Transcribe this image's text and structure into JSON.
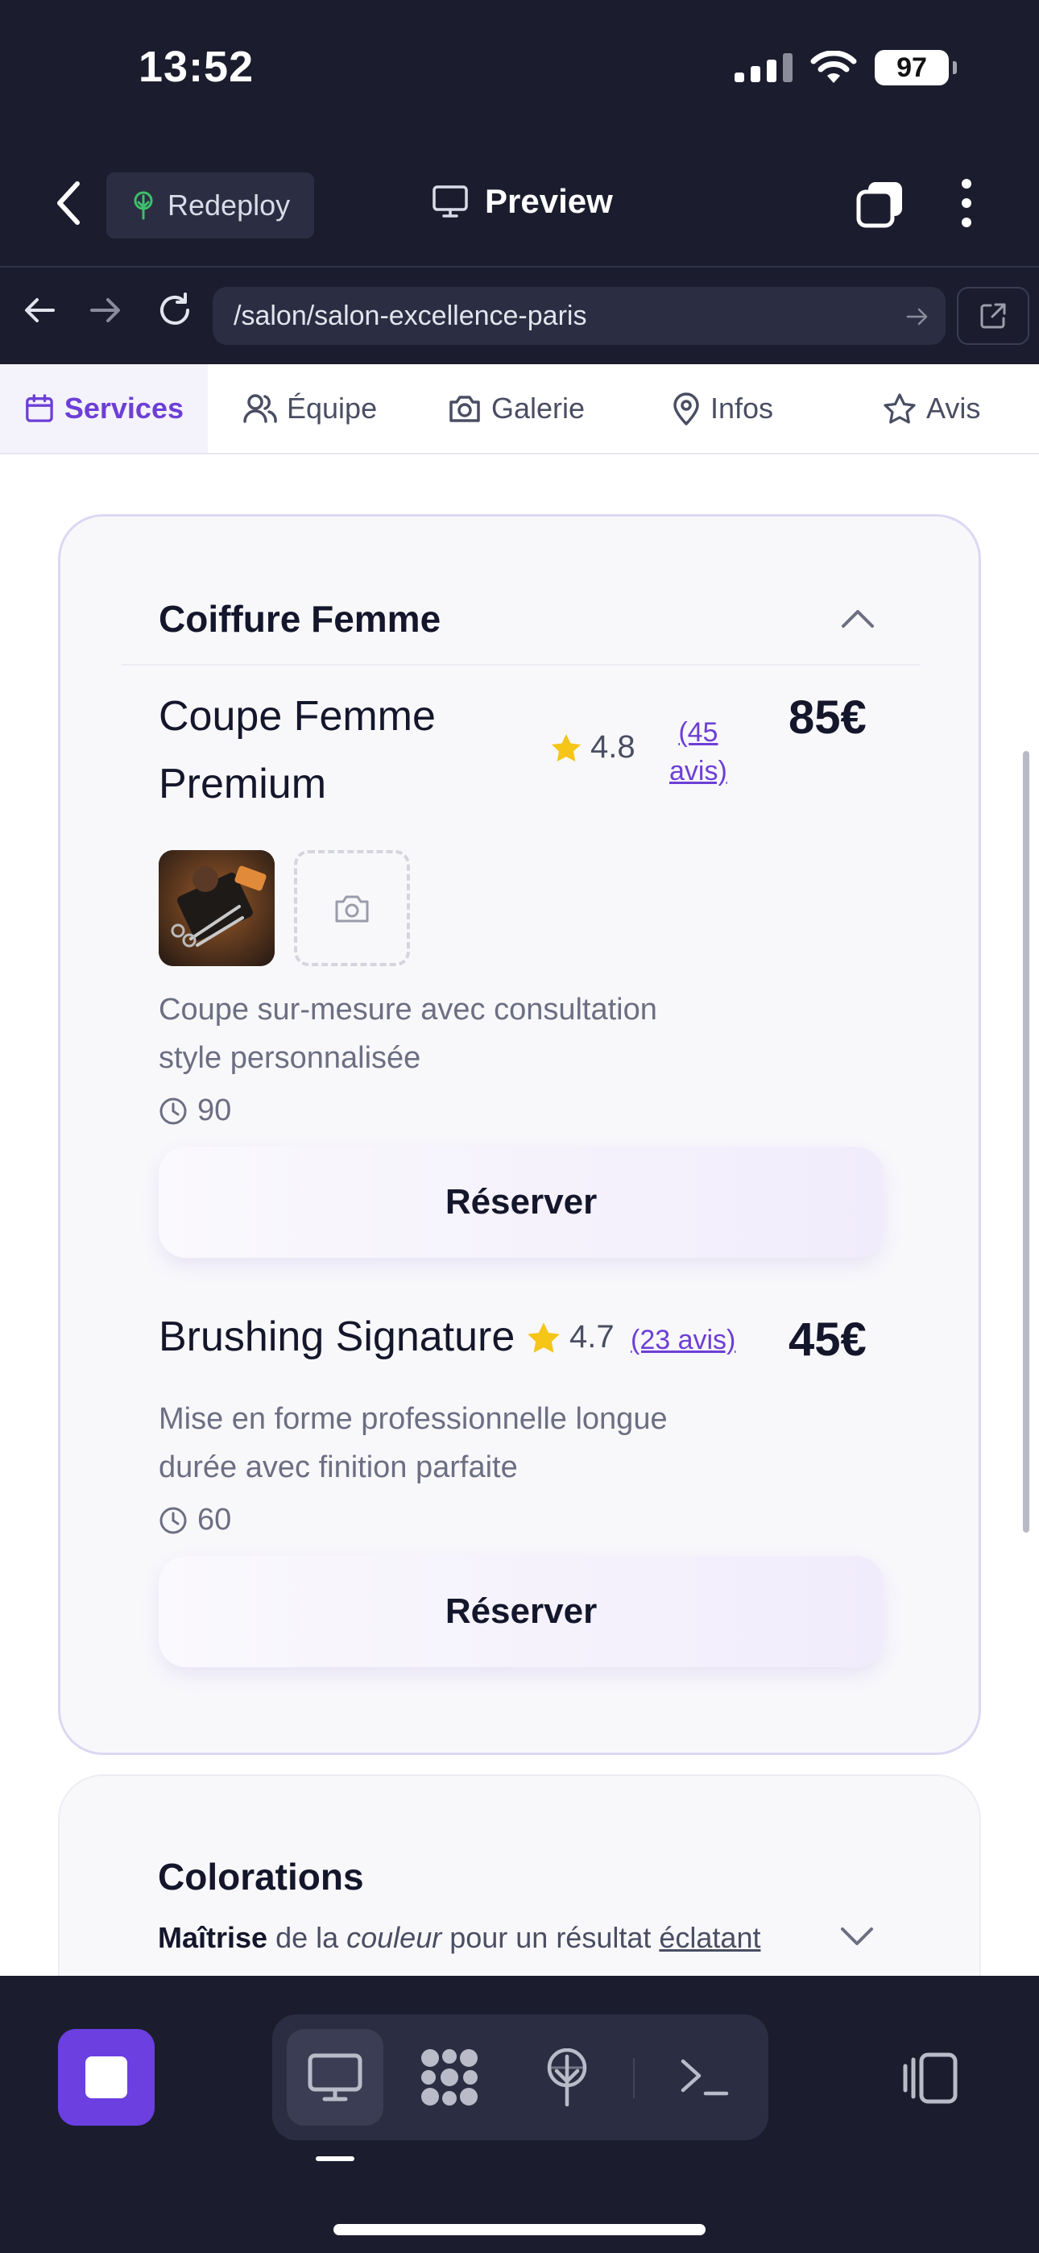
{
  "status_bar": {
    "time": "13:52",
    "battery": "97"
  },
  "app_header": {
    "redeploy_label": "Redeploy",
    "preview_label": "Preview"
  },
  "browser": {
    "url": "/salon/salon-excellence-paris"
  },
  "tabs": [
    {
      "label": "Services",
      "icon": "calendar-icon",
      "active": true
    },
    {
      "label": "Équipe",
      "icon": "users-icon",
      "active": false
    },
    {
      "label": "Galerie",
      "icon": "camera-icon",
      "active": false
    },
    {
      "label": "Infos",
      "icon": "map-pin-icon",
      "active": false
    },
    {
      "label": "Avis",
      "icon": "star-icon",
      "active": false
    }
  ],
  "categories": [
    {
      "title": "Coiffure Femme",
      "expanded": true,
      "services": [
        {
          "name_line1": "Coupe Femme",
          "name_line2": "Premium",
          "rating": "4.8",
          "reviews_line1": "(45",
          "reviews_line2": "avis)",
          "price": "85€",
          "description_line1": "Coupe sur-mesure avec consultation",
          "description_line2": "style personnalisée",
          "duration": "90",
          "book_label": "Réserver"
        },
        {
          "name": "Brushing Signature",
          "rating": "4.7",
          "reviews": "(23 avis)",
          "price": "45€",
          "description_line1": "Mise en forme professionnelle longue",
          "description_line2": "durée avec finition parfaite",
          "duration": "60",
          "book_label": "Réserver"
        }
      ]
    },
    {
      "title": "Colorations",
      "expanded": false,
      "subtitle_bold": "Maîtrise",
      "subtitle_mid1": " de la ",
      "subtitle_italic": "couleur",
      "subtitle_mid2": " pour un résultat ",
      "subtitle_underline": "éclatant"
    }
  ],
  "colors": {
    "accent": "#6d3fd6",
    "stop_button": "#6b3fe0",
    "star": "#f5c518",
    "dark_bg": "#1b1d2e"
  }
}
